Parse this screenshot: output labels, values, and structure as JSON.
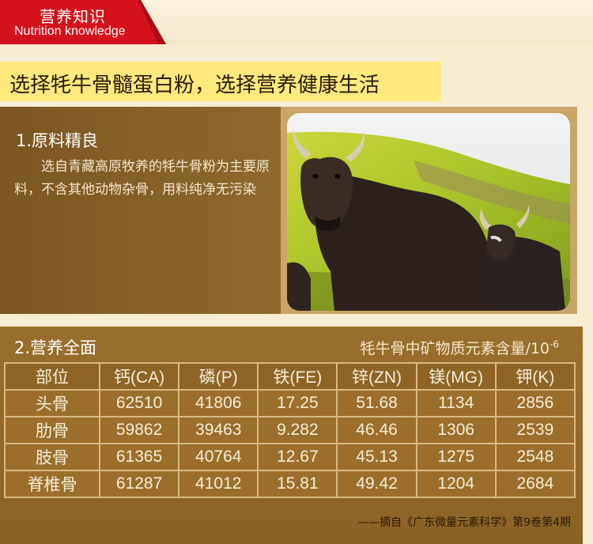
{
  "header": {
    "tag_cn": "营养知识",
    "tag_en": "Nutrition knowledge"
  },
  "slogan": "选择牦牛骨髓蛋白粉，选择营养健康生活",
  "section1": {
    "title": "1.原料精良",
    "body": "选自青藏高原牧养的牦牛骨粉为主要原料，不含其他动物杂骨，用料纯净无污染"
  },
  "section2": {
    "title": "2.营养全面",
    "caption": "牦牛骨中矿物质元素含量/10",
    "caption_exp": "-6",
    "table": {
      "headers": [
        "部位",
        "钙(CA)",
        "磷(P)",
        "铁(FE)",
        "锌(ZN)",
        "镁(MG)",
        "钾(K)"
      ],
      "rows": [
        [
          "头骨",
          "62510",
          "41806",
          "17.25",
          "51.68",
          "1134",
          "2856"
        ],
        [
          "肋骨",
          "59862",
          "39463",
          "9.282",
          "46.46",
          "1306",
          "2539"
        ],
        [
          "肢骨",
          "61365",
          "40764",
          "12.67",
          "45.13",
          "1275",
          "2548"
        ],
        [
          "脊椎骨",
          "61287",
          "41012",
          "15.81",
          "49.42",
          "1204",
          "2684"
        ]
      ]
    },
    "source": "——摘自《广东微量元素科学》第9卷第4期"
  },
  "colors": {
    "tag_red": "#d4121b",
    "slogan_yellow": "#fde97d",
    "panel_brown": "#7b5620",
    "table_brown": "#9b6f2b"
  }
}
